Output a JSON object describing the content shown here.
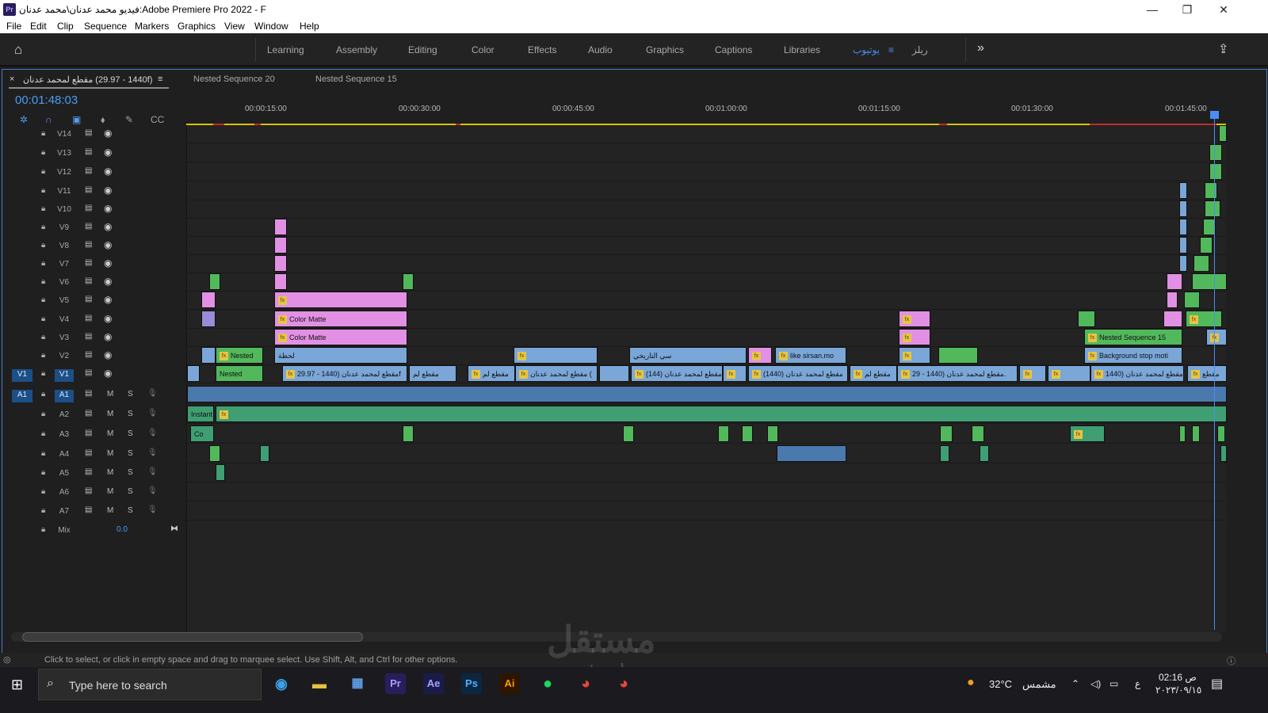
{
  "window": {
    "title": "فيديو محمد عدنان\\محمد عدنان:Adobe Premiere Pro 2022 - F",
    "minimize": "—",
    "maximize": "❐",
    "close": "✕"
  },
  "menu": [
    "File",
    "Edit",
    "Clip",
    "Sequence",
    "Markers",
    "Graphics",
    "View",
    "Window",
    "Help"
  ],
  "workspaces": {
    "tabs": [
      "Learning",
      "Assembly",
      "Editing",
      "Color",
      "Effects",
      "Audio",
      "Graphics",
      "Captions",
      "Libraries",
      "يوتيوب",
      "≡",
      "ريلز"
    ],
    "active": "يوتيوب",
    "more": "»"
  },
  "timeline": {
    "tabs": {
      "active": "مقطع لمحمد عدنان (1440 - 29.97f)",
      "others": [
        "Nested Sequence 20",
        "Nested Sequence 15"
      ]
    },
    "close_label": "×",
    "menu_label": "≡",
    "timecode": "00:01:48:03",
    "ruler": [
      "00:00:15:00",
      "00:00:30:00",
      "00:00:45:00",
      "00:01:00:00",
      "00:01:15:00",
      "00:01:30:00",
      "00:01:45:00"
    ],
    "video_tracks": [
      "V14",
      "V13",
      "V12",
      "V11",
      "V10",
      "V9",
      "V8",
      "V7",
      "V6",
      "V5",
      "V4",
      "V3",
      "V2",
      "V1"
    ],
    "audio_tracks": [
      "A1",
      "A2",
      "A3",
      "A4",
      "A5",
      "A6",
      "A7"
    ],
    "source_v": "V1",
    "source_a": "A1",
    "mute_label": "M",
    "solo_label": "S",
    "mix_label": "Mix",
    "mix_value": "0.0",
    "clips": {
      "nested": "Nested",
      "color_matte": "Color Matte",
      "laghza": "لحظة",
      "main": "مقطع لمحمد عدنان (1440 - 29.97f",
      "short1": "مقطع لم",
      "short2": "مقطع لم",
      "main2": "مقطع لمحمد عدنان (",
      "main3": "مقطع لمحمد عدنان (144)",
      "main4": "مقطع لمحمد عدنان (1440)",
      "short3": "مقطع لم",
      "main5": "مقطع لمحمد عدنان (1440 - 29.",
      "main6": "مقطع لمحمد عدنان (1440",
      "tail": "مقطع",
      "tarikhi": "سي التاريخي",
      "like": "like sirsan.mo",
      "dot": ".",
      "nested15": "Nested Sequence 15",
      "background": "Background stop moti",
      "instant": "Instant Pc",
      "co": "Co"
    }
  },
  "status": {
    "message": "Click to select, or click in empty space and drag to marquee select. Use Shift, Alt, and Ctrl for other options."
  },
  "taskbar": {
    "search_placeholder": "Type here to search",
    "apps": [
      "Pr",
      "Ae",
      "Ps",
      "Ai"
    ],
    "weather": "32°C",
    "weather_desc": "مشمس",
    "lang": "ع",
    "time": "02:16 ص",
    "date": "٢٠٢٣/٠٩/١٥"
  },
  "watermark": {
    "ar": "مستقل",
    "en": "mostaql.com"
  },
  "colors": {
    "accent": "#4a8ef2",
    "video_clip": "#7aa6d8",
    "pink_clip": "#e290e4",
    "green_clip": "#52b85c",
    "audio_clip": "#4a79ad"
  }
}
